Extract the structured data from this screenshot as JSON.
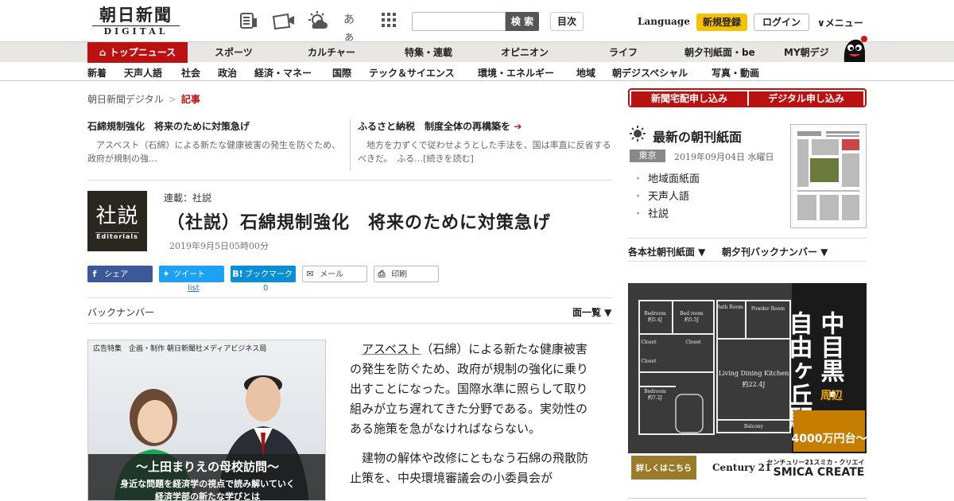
{
  "header": {
    "logo_kanji": "朝日新聞",
    "logo_sub": "DIGITAL",
    "search_button": "検 索",
    "toc_button": "目次",
    "language": "Language",
    "register": "新規登録",
    "login": "ログイン",
    "menu": "∨メニュー",
    "font_size_glyph": "あぁ"
  },
  "nav_primary": [
    "トップニュース",
    "スポーツ",
    "カルチャー",
    "特集・連載",
    "オピニオン",
    "ライフ",
    "朝夕刊紙面・be",
    "MY朝デジ"
  ],
  "nav_secondary": [
    "新着",
    "天声人語",
    "社会",
    "政治",
    "経済・マネー",
    "国際",
    "テック＆サイエンス",
    "環境・エネルギー",
    "地域",
    "朝デジスペシャル",
    "写真・動画"
  ],
  "breadcrumb": {
    "home": "朝日新聞デジタル",
    "sep": ">",
    "current": "記事"
  },
  "related": [
    {
      "title": "石綿規制強化　将来のために対策急げ",
      "body": "アスベスト（石綿）による新たな健康被害の発生を防ぐため、政府が規制の強…"
    },
    {
      "title": "ふるさと納税　制度全体の再構築を",
      "arrow": "➔",
      "body": "地方を力ずくで従わせようとした手法を、国は率直に反省するべきだ。　ふる…[続きを読む]"
    }
  ],
  "article": {
    "thumb_big": "社説",
    "thumb_small": "Editorials",
    "series": "連載：社説",
    "title": "（社説）石綿規制強化　将来のために対策急げ",
    "date": "2019年9月5日05時00分",
    "share": {
      "facebook": "シェア",
      "twitter": "ツイート",
      "hatena": "ブックマーク",
      "mail": "メール",
      "print": "印刷",
      "tweet_count": "list",
      "bookmark_count": "0"
    },
    "backnumber": "バックナンバー",
    "menlist": "面一覧 ▼",
    "body_link": "アスベスト",
    "body_p1_rest": "（石綿）による新たな健康被害の発生を防ぐため、政府が規制の強化に乗り出すことになった。国際水準に照らして取り組みが立ち遅れてきた分野である。実効性のある施策を急がなければならない。",
    "body_p2": "建物の解体や改修にともなう石綿の飛散防止策を、中央環境審議会の小委員会が"
  },
  "ad_left": {
    "label": "広告特集　企画・制作 朝日新聞社メディアビジネス局",
    "headline": "〜上田まりえの母校訪問〜",
    "sub1": "身近な問題を経済学の視点で読み解いていく",
    "sub2": "経済学部の新たな学びとは"
  },
  "sidebar": {
    "apply_delivery": "新聞宅配申し込み",
    "apply_digital": "デジタル申し込み",
    "latest_title": "最新の朝刊紙面",
    "region": "東京",
    "paper_date": "2019年09月04日 水曜日",
    "paper_links": [
      "地域面紙面",
      "天声人語",
      "社説"
    ],
    "sub_links": [
      "各本社朝刊紙面 ▼",
      "朝夕刊バックナンバー ▼"
    ]
  },
  "ad_right": {
    "bedroom1": "Bedroom",
    "bedroom1_size": "約5.4J",
    "bedroom2": "Bed room",
    "bedroom2_size": "約5.5J",
    "bath": "Bath Room",
    "powder": "Powder Room",
    "closet": "Closet",
    "bedroom3": "Bedroom",
    "bedroom3_size": "約7.2J",
    "ldk": "Living Dining Kitchen",
    "ldk_size": "約22.4J",
    "balcony": "Balcony",
    "place1": "中目黒・",
    "place2": "自由ヶ丘駅",
    "near": "周辺",
    "price": "4000万円台〜",
    "more": "詳しくはこちら",
    "brand_logo": "Century 21",
    "company_small": "センチュリー21スミカ・クリエイト",
    "company_big": "SMICA CREATE"
  },
  "colors": {
    "accent_red": "#bb1111",
    "yellow": "#f5c200",
    "facebook": "#3b5998",
    "twitter": "#1da1f2",
    "hatena": "#0a8ed6"
  }
}
